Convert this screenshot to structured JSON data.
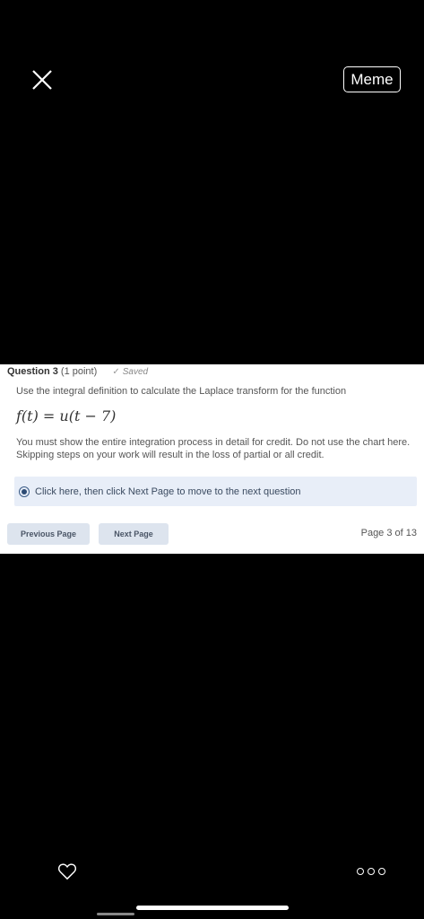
{
  "top_bar": {
    "meme_label": "Meme"
  },
  "question": {
    "title": "Question 3",
    "points": "(1 point)",
    "saved": "Saved",
    "instruction": "Use the integral definition to calculate the Laplace transform for the function",
    "formula": "f(t) = u(t − 7)",
    "note": "You must show the entire integration process in detail for credit.  Do not use the chart here.  Skipping steps on your work will result in the loss of partial or all credit.",
    "option_label": "Click here, then click Next Page to move to the next question",
    "option_selected": true
  },
  "navigation": {
    "previous_label": "Previous Page",
    "next_label": "Next Page",
    "page_indicator": "Page 3 of 13"
  }
}
